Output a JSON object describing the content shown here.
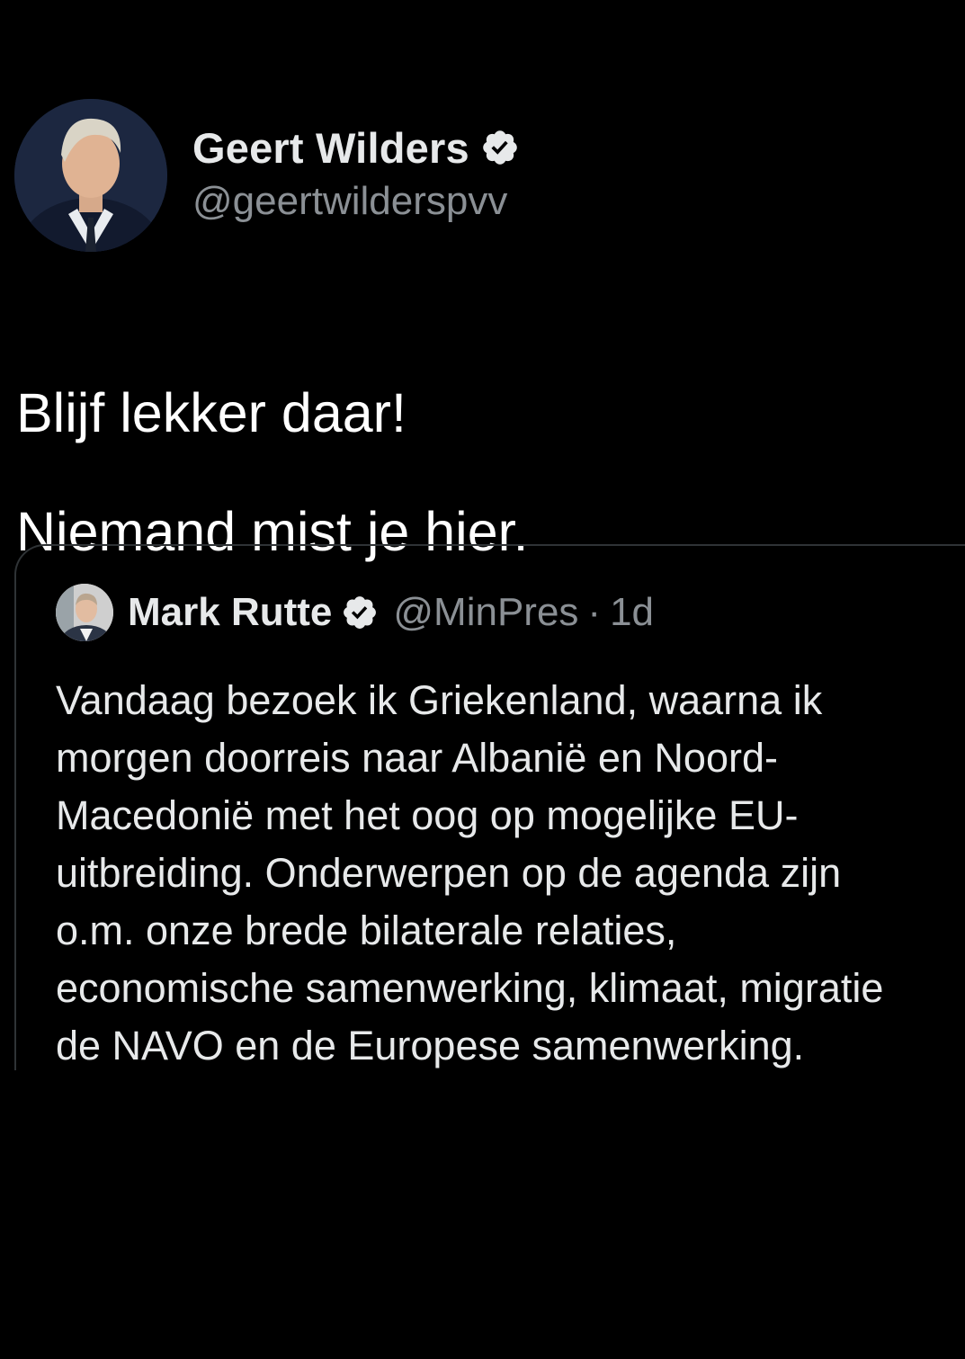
{
  "colors": {
    "background": "#000000",
    "text_primary": "#e7e9ea",
    "text_secondary": "#8b9095",
    "border": "#2f3336",
    "verified_badge": "#e7e9ea"
  },
  "tweet": {
    "author": {
      "display_name": "Geert Wilders",
      "handle": "@geertwilderspvv",
      "verified": true,
      "avatar_icon": "profile-photo"
    },
    "text_lines": [
      "Blijf lekker daar!",
      "Niemand mist je hier."
    ],
    "quoted_tweet": {
      "author": {
        "display_name": "Mark Rutte",
        "handle": "@MinPres",
        "verified": true,
        "avatar_icon": "profile-photo"
      },
      "separator": "·",
      "timestamp": "1d",
      "text_lines": [
        "Vandaag bezoek ik Griekenland, waarna ik",
        "morgen doorreis naar Albanië en Noord-",
        "Macedonië met het oog op mogelijke EU-",
        "uitbreiding. Onderwerpen op de agenda zijn",
        "o.m. onze brede bilaterale relaties,",
        "economische samenwerking, klimaat, migratie",
        "de NAVO en de Europese samenwerking."
      ]
    }
  }
}
